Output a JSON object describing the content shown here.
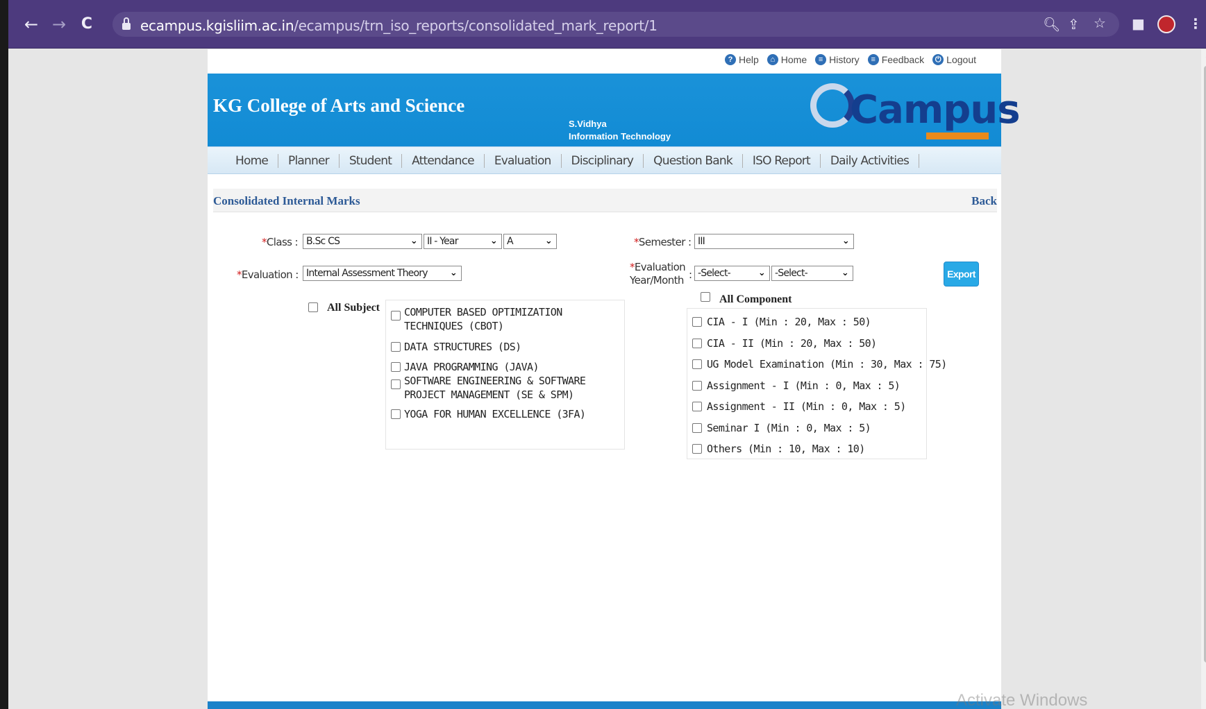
{
  "browser": {
    "back": "←",
    "forward": "→",
    "reload": "C",
    "url_host": "ecampus.kgisliim.ac.in",
    "url_path": "/ecampus/trn_iso_reports/consolidated_mark_report/1",
    "zoom_icon": "zoom-icon",
    "share_icon": "share-icon",
    "star_icon": "bookmark-star-icon",
    "menu_icon": "kebab-menu-icon"
  },
  "toplinks": {
    "help": "Help",
    "home": "Home",
    "history": "History",
    "feedback": "Feedback",
    "logout": "Logout"
  },
  "header": {
    "college": "KG College of Arts and Science",
    "user_name": "S.Vidhya",
    "department": "Information Technology",
    "logo_text": "Campus"
  },
  "menu": [
    "Home",
    "Planner",
    "Student",
    "Attendance",
    "Evaluation",
    "Disciplinary",
    "Question Bank",
    "ISO Report",
    "Daily Activities"
  ],
  "section": {
    "title": "Consolidated Internal Marks",
    "back": "Back"
  },
  "form": {
    "class_label": "Class :",
    "class_value": "B.Sc CS",
    "year_value": "II - Year",
    "section_value": "A",
    "semester_label": "Semester :",
    "semester_value": "III",
    "evaluation_label": "Evaluation :",
    "evaluation_value": "Internal Assessment Theory",
    "eval_ym_label_1": "Evaluation",
    "eval_ym_label_2": "Year/Month",
    "eval_ym_colon": ":",
    "year_select": "-Select-",
    "month_select": "-Select-",
    "export": "Export",
    "required_mark": "*"
  },
  "subjects": {
    "all_label": "All Subject",
    "items": [
      {
        "line1": "COMPUTER BASED OPTIMIZATION",
        "line2": "TECHNIQUES (CBOT)"
      },
      {
        "line1": "DATA STRUCTURES (DS)",
        "line2": ""
      },
      {
        "line1": "JAVA PROGRAMMING (JAVA)",
        "line2": ""
      },
      {
        "line1": "SOFTWARE ENGINEERING & SOFTWARE",
        "line2": "PROJECT MANAGEMENT (SE & SPM)"
      },
      {
        "line1": "YOGA FOR HUMAN EXCELLENCE (3FA)",
        "line2": ""
      }
    ]
  },
  "components": {
    "all_label": "All Component",
    "items": [
      "CIA - I (Min : 20, Max : 50)",
      "CIA - II (Min : 20, Max : 50)",
      "UG Model Examination (Min : 30, Max : 75)",
      "Assignment - I (Min : 0, Max : 5)",
      "Assignment - II (Min : 0, Max : 5)",
      "Seminar I (Min : 0, Max : 5)",
      "Others (Min : 10, Max : 10)"
    ]
  },
  "watermark": "Activate Windows"
}
